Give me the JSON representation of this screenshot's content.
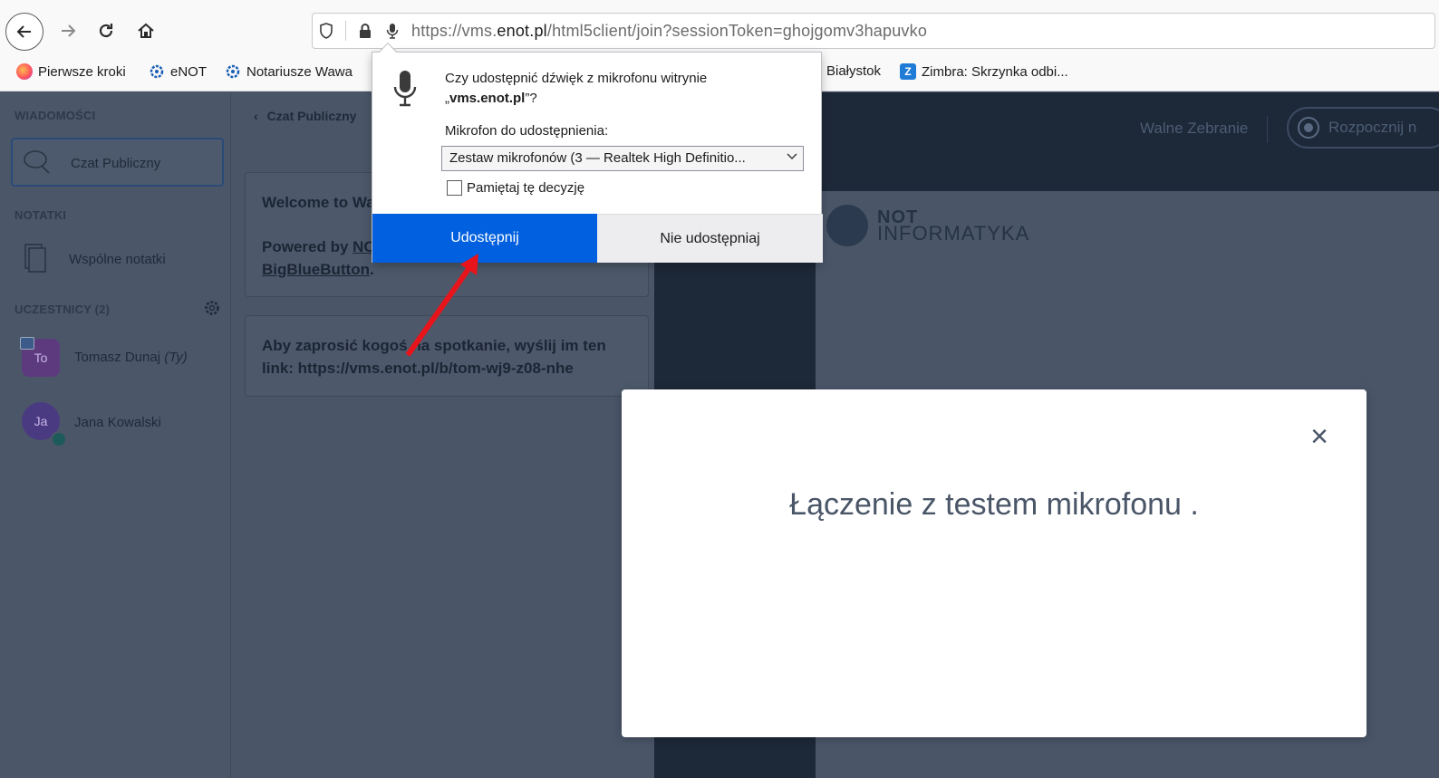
{
  "browser": {
    "url_prefix": "https://vms.",
    "url_domain": "enot.pl",
    "url_path": "/html5client/join?sessionToken=ghojgomv3hapuvko"
  },
  "bookmarks": [
    {
      "label": "Pierwsze kroki",
      "icon": "firefox-icon"
    },
    {
      "label": "eNOT",
      "icon": "gear-icon"
    },
    {
      "label": "Notariusze Wawa",
      "icon": "gear-icon"
    },
    {
      "label": "Białystok",
      "icon": ""
    },
    {
      "label": "Zimbra: Skrzynka odbi...",
      "icon": "zimbra-icon"
    }
  ],
  "sidebar": {
    "messages_title": "WIADOMOŚCI",
    "public_chat": "Czat Publiczny",
    "notes_title": "NOTATKI",
    "shared_notes": "Wspólne notatki",
    "participants_title": "UCZESTNICY (2)",
    "users": [
      {
        "initials": "To",
        "name": "Tomasz Dunaj",
        "suffix": "(Ty)"
      },
      {
        "initials": "Ja",
        "name": "Jana Kowalski",
        "suffix": ""
      }
    ]
  },
  "chat": {
    "back_label": "Czat Publiczny",
    "welcome_line": "Welcome to Wa",
    "powered_prefix": "Powered by ",
    "powered_link": "NC",
    "bbb_link": "BigBlueButton",
    "bbb_suffix": ".",
    "invite_text": "Aby zaprosić kogoś na spotkanie, wyślij im ten link: https://vms.enot.pl/b/tom-wj9-z08-nhe"
  },
  "meeting": {
    "title": "Walne Zebranie",
    "record_label": "Rozpocznij n"
  },
  "logo": {
    "line1": "NOT",
    "line2": "INFORMATYKA"
  },
  "modal": {
    "close": "×",
    "message": "Łączenie z testem mikrofonu ."
  },
  "permission": {
    "question_prefix": "Czy udostępnić dźwięk z mikrofonu witrynie",
    "question_site_open": "„",
    "question_site": "vms.enot.pl",
    "question_site_close": "”?",
    "mic_label": "Mikrofon do udostępnienia:",
    "mic_option": "Zestaw mikrofonów (3 — Realtek High Definitio...",
    "remember_label": "Pamiętaj tę decyzję",
    "allow_label": "Udostępnij",
    "deny_label": "Nie udostępniaj"
  },
  "colors": {
    "accent": "#0060df",
    "arrow": "#e8141b"
  }
}
